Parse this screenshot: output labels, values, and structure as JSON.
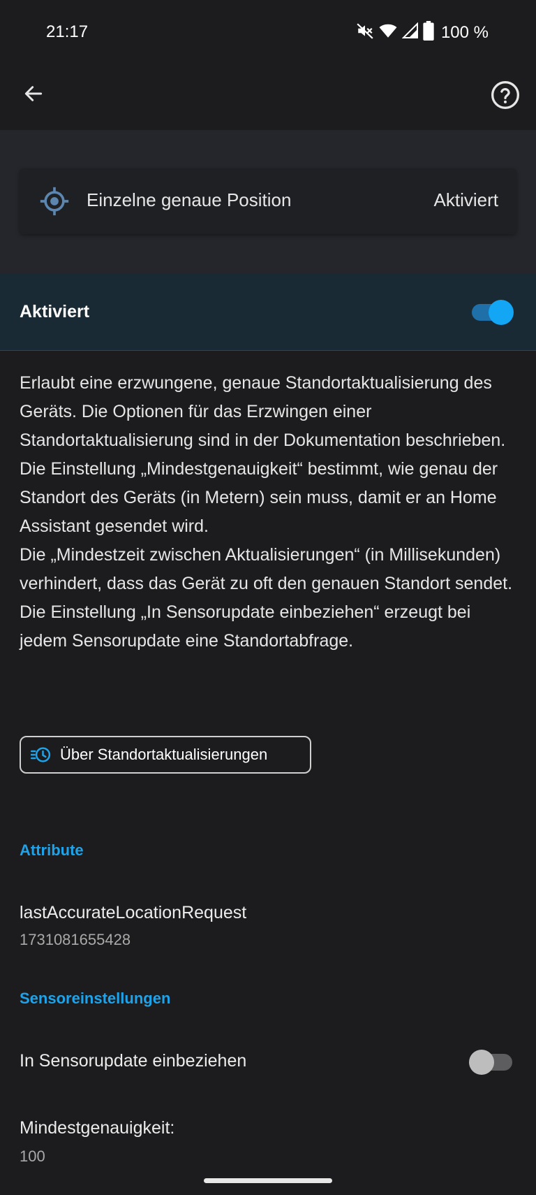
{
  "status_bar": {
    "time": "21:17",
    "battery_text": "100 %",
    "icons": [
      "mute-icon",
      "wifi-icon",
      "signal-icon",
      "battery-icon"
    ]
  },
  "app_bar": {
    "back_icon": "arrow-left-icon",
    "help_icon": "help-circle-icon"
  },
  "sensor": {
    "icon": "crosshairs-gps-icon",
    "name": "Einzelne genaue Position",
    "state": "Aktiviert"
  },
  "enable": {
    "label": "Aktiviert",
    "enabled": true
  },
  "description": {
    "paragraphs": [
      "Erlaubt eine erzwungene, genaue Standortaktualisierung des Geräts. Die Optionen für das Erzwingen einer Standortaktualisierung sind in der Dokumentation beschrieben.",
      "Die Einstellung „Mindestgenauigkeit“ bestimmt, wie genau der Standort des Geräts (in Metern) sein muss, damit er an Home Assistant gesendet wird.",
      "Die „Mindestzeit zwischen Aktualisierungen“ (in Millisekunden) verhindert, dass das Gerät zu oft den genauen Standort sendet.",
      "Die Einstellung „In Sensorupdate einbeziehen“ erzeugt bei jedem Sensorupdate eine Standortabfrage."
    ]
  },
  "doc_button": {
    "label": "Über Standortaktualisierungen",
    "icon": "clock-fast-icon"
  },
  "attributes": {
    "title": "Attribute",
    "items": [
      {
        "name": "lastAccurateLocationRequest",
        "value": "1731081655428"
      }
    ]
  },
  "settings": {
    "title": "Sensoreinstellungen",
    "include_in_update": {
      "label": "In Sensorupdate einbeziehen",
      "enabled": false
    },
    "min_accuracy": {
      "label": "Mindestgenauigkeit:",
      "value": "100"
    }
  },
  "colors": {
    "accent": "#1ea3ea",
    "switch_on": "#13a6f5",
    "background": "#1c1c1e"
  }
}
